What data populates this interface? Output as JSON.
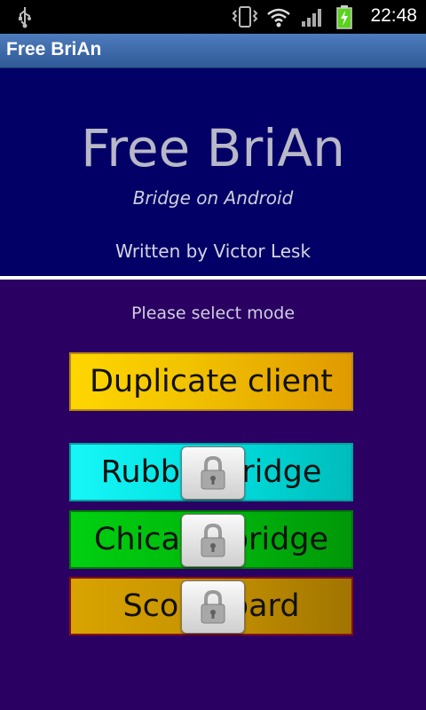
{
  "status_bar": {
    "time": "22:48",
    "icons": [
      "usb-icon",
      "vibrate-icon",
      "wifi-icon",
      "signal-icon",
      "battery-charging-icon"
    ]
  },
  "title_bar": {
    "title": "Free BriAn"
  },
  "header": {
    "app_name": "Free BriAn",
    "subtitle": "Bridge on Android",
    "author": "Written by Victor Lesk"
  },
  "prompt": "Please select mode",
  "modes": [
    {
      "label": "Duplicate client",
      "locked": false
    },
    {
      "label": "Rubber bridge",
      "locked": true
    },
    {
      "label": "Chicago bridge",
      "locked": true
    },
    {
      "label": "Scoreboard",
      "locked": true
    }
  ],
  "colors": {
    "header_bg": "#020066",
    "body_bg": "#2a0062",
    "duplicate": "#ffd600",
    "rubber": "#00e0e0",
    "chicago": "#00b80c",
    "scoreboard": "#c69200"
  }
}
